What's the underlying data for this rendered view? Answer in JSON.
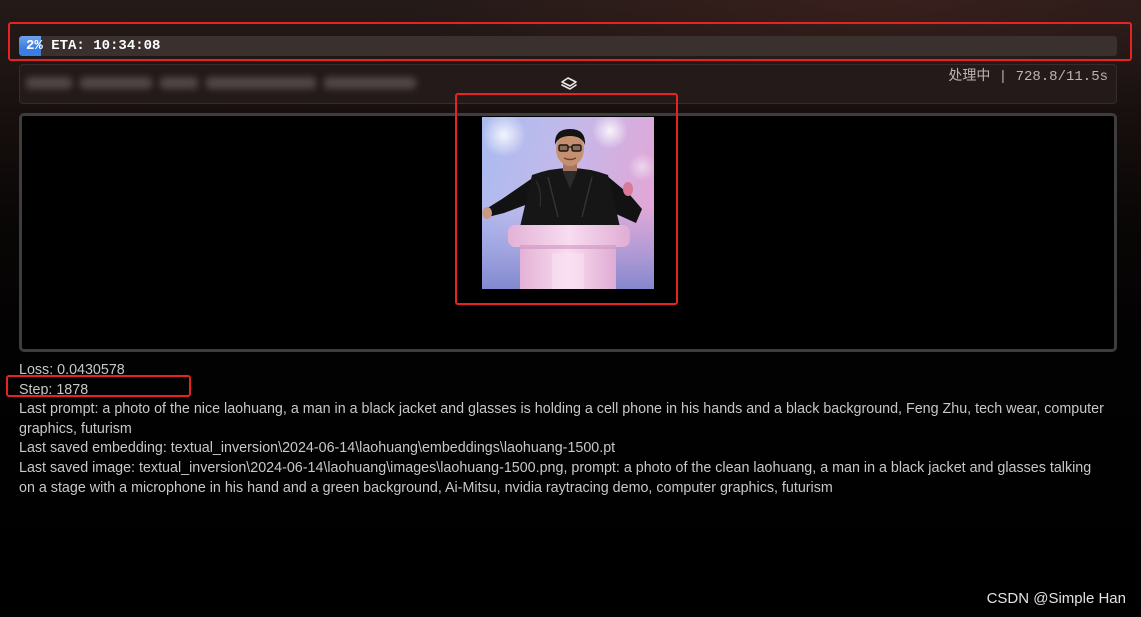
{
  "progress": {
    "fraction": 0.02,
    "label": "2% ETA: 10:34:08",
    "fill_color": "#3a7ee4"
  },
  "status": {
    "icon": "loading-icon",
    "detail": "处理中 | 728.8/11.5s"
  },
  "log": {
    "loss": "Loss: 0.0430578",
    "step": "Step: 1878",
    "last_prompt": "Last prompt: a photo of the nice laohuang, a man in a black jacket and glasses is holding a cell phone in his hands and a black background, Feng Zhu, tech wear, computer graphics, futurism",
    "last_embedding": "Last saved embedding: textual_inversion\\2024-06-14\\laohuang\\embeddings\\laohuang-1500.pt",
    "last_image": "Last saved image: textual_inversion\\2024-06-14\\laohuang\\images\\laohuang-1500.png, prompt: a photo of the clean laohuang, a man in a black jacket and glasses talking on a stage with a microphone in his hand and a green background, Ai-Mitsu, nvidia raytracing demo, computer graphics, futurism"
  },
  "watermark": "CSDN @Simple Han",
  "annotation_color": "#e52320"
}
